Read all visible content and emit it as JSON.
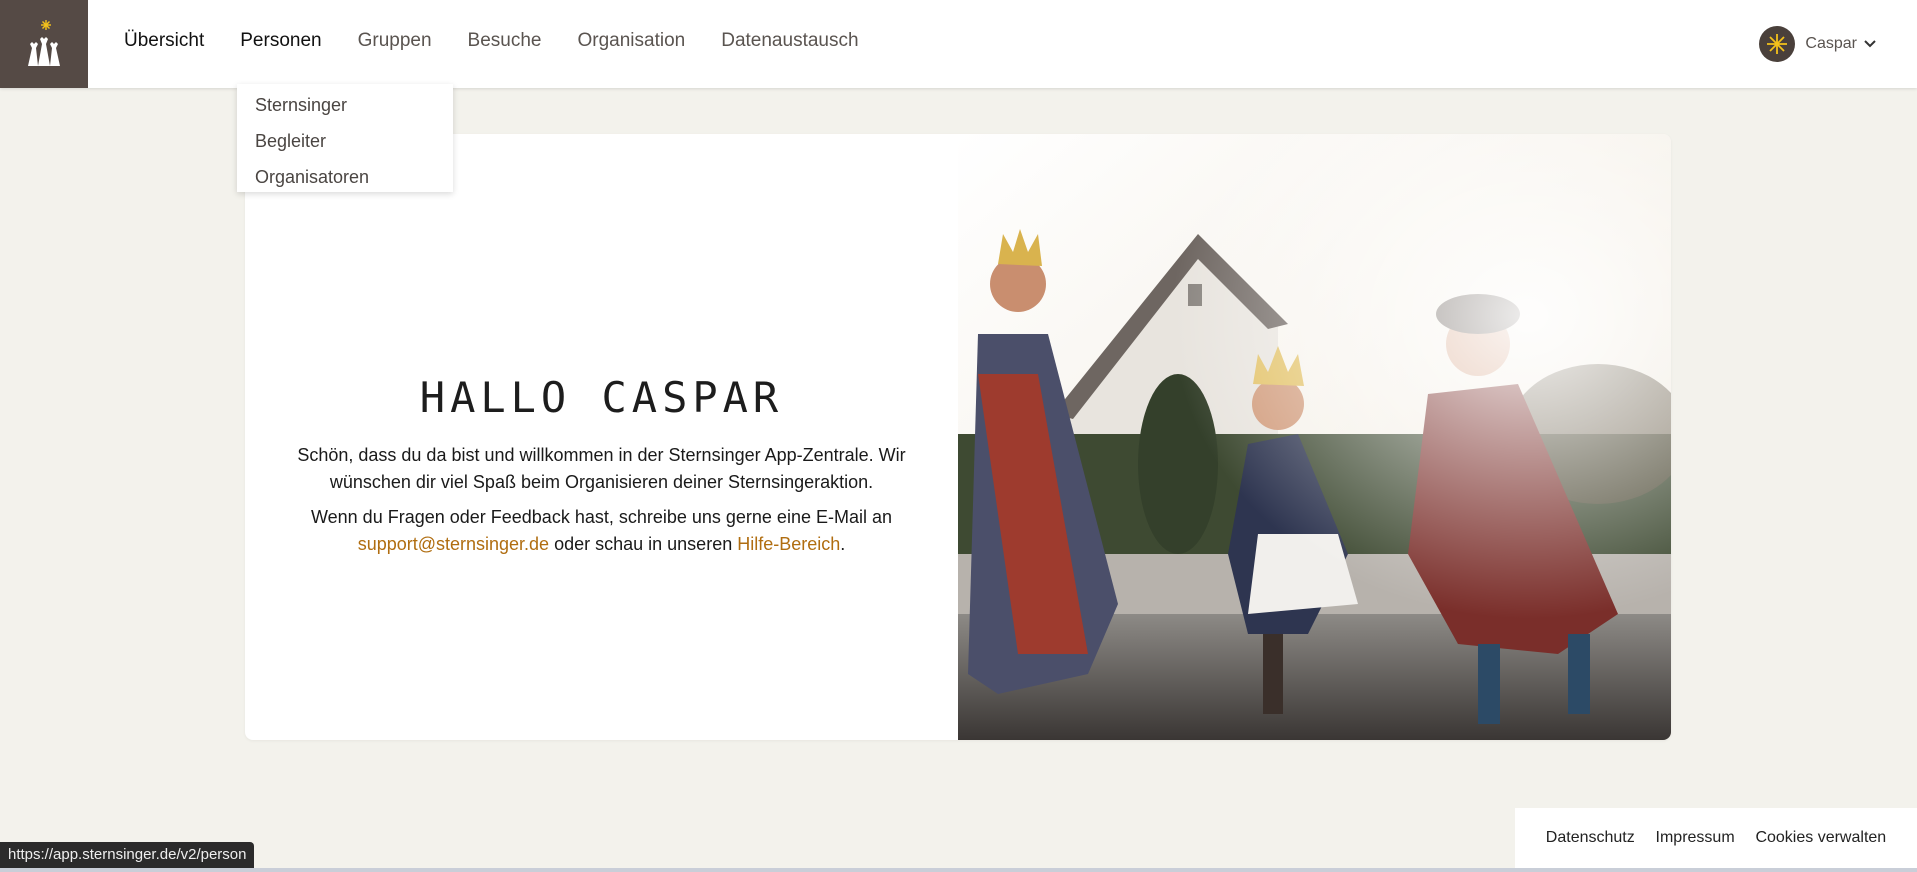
{
  "header": {
    "logo_icon": "three-kings-star-logo",
    "nav": [
      {
        "label": "Übersicht",
        "active": true
      },
      {
        "label": "Personen",
        "active": true
      },
      {
        "label": "Gruppen",
        "active": false
      },
      {
        "label": "Besuche",
        "active": false
      },
      {
        "label": "Organisation",
        "active": false
      },
      {
        "label": "Datenaustausch",
        "active": false
      }
    ],
    "user": {
      "name": "Caspar",
      "avatar_icon": "star-avatar-icon",
      "menu_icon": "chevron-down-icon"
    }
  },
  "dropdown": {
    "items": [
      {
        "label": "Sternsinger"
      },
      {
        "label": "Begleiter"
      },
      {
        "label": "Organisatoren"
      }
    ]
  },
  "welcome": {
    "title": "Hallo Caspar",
    "text1": "Schön, dass du da bist und willkommen in der Sternsinger App-Zentrale. Wir wünschen dir viel Spaß beim Organisieren deiner Sternsingeraktion.",
    "text2_before": "Wenn du Fragen oder Feedback hast, schreibe uns gerne eine E-Mail an",
    "email_link": "support@sternsinger.de",
    "text2_middle": "oder schau in unseren",
    "help_link": "Hilfe-Bereich",
    "text2_end": "."
  },
  "footer": {
    "links": [
      {
        "label": "Datenschutz"
      },
      {
        "label": "Impressum"
      },
      {
        "label": "Cookies verwalten"
      }
    ]
  },
  "statusbar": {
    "url": "https://app.sternsinger.de/v2/person"
  },
  "colors": {
    "brand_dark": "#554a45",
    "accent_link": "#b06d10",
    "background": "#f3f2ec"
  }
}
